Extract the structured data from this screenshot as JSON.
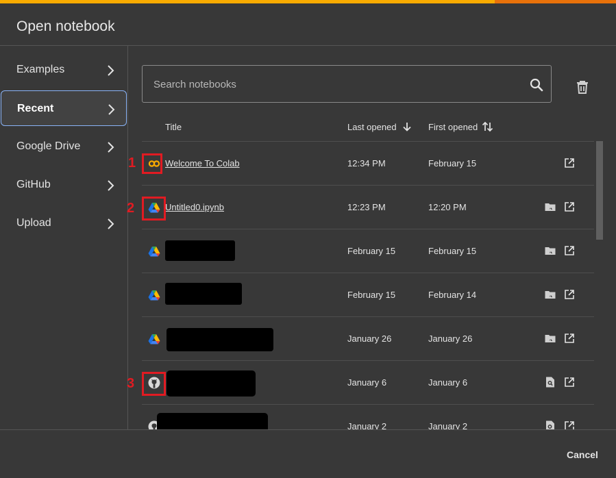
{
  "dialog": {
    "title": "Open notebook"
  },
  "sidebar": {
    "items": [
      {
        "label": "Examples"
      },
      {
        "label": "Recent"
      },
      {
        "label": "Google Drive"
      },
      {
        "label": "GitHub"
      },
      {
        "label": "Upload"
      }
    ],
    "active": "Recent"
  },
  "search": {
    "placeholder": "Search notebooks",
    "value": ""
  },
  "table": {
    "columns": {
      "title": "Title",
      "last_opened": "Last opened",
      "first_opened": "First opened"
    },
    "rows": [
      {
        "icon": "colab-icon",
        "title": "Welcome To Colab",
        "last_opened": "12:34 PM",
        "first_opened": "February 15",
        "title_redacted": false
      },
      {
        "icon": "google-drive-icon",
        "title": "Untitled0.ipynb",
        "last_opened": "12:23 PM",
        "first_opened": "12:20 PM",
        "title_redacted": false
      },
      {
        "icon": "google-drive-icon",
        "title": "",
        "last_opened": "February 15",
        "first_opened": "February 15",
        "title_redacted": true
      },
      {
        "icon": "google-drive-icon",
        "title": "",
        "last_opened": "February 15",
        "first_opened": "February 14",
        "title_redacted": true
      },
      {
        "icon": "google-drive-icon",
        "title": "",
        "last_opened": "January 26",
        "first_opened": "January 26",
        "title_redacted": true
      },
      {
        "icon": "github-icon",
        "title": "",
        "last_opened": "January 6",
        "first_opened": "January 6",
        "title_redacted": true
      },
      {
        "icon": "github-icon",
        "title": "",
        "last_opened": "January 2",
        "first_opened": "January 2",
        "title_redacted": true
      }
    ]
  },
  "annotations": [
    {
      "number": "1"
    },
    {
      "number": "2"
    },
    {
      "number": "3"
    }
  ],
  "footer": {
    "cancel_label": "Cancel"
  },
  "colors": {
    "background": "#383838",
    "accent_orange": "#f9ab00",
    "active_border": "#8ab4f8",
    "annotation_red": "#e11b22"
  }
}
